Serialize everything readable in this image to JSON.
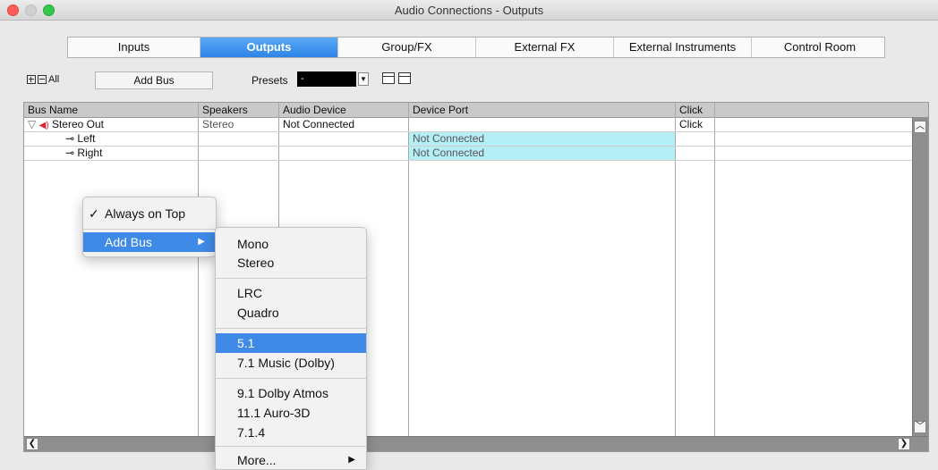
{
  "window": {
    "title": "Audio Connections - Outputs"
  },
  "tabs": [
    {
      "label": "Inputs"
    },
    {
      "label": "Outputs"
    },
    {
      "label": "Group/FX"
    },
    {
      "label": "External FX"
    },
    {
      "label": "External Instruments"
    },
    {
      "label": "Control Room"
    }
  ],
  "toolbar": {
    "all_label": "All",
    "add_bus_label": "Add Bus",
    "presets_label": "Presets",
    "presets_value": "-"
  },
  "table": {
    "headers": [
      "Bus Name",
      "Speakers",
      "Audio Device",
      "Device Port",
      "Click"
    ],
    "rows": [
      {
        "bus": "Stereo Out",
        "speakers": "Stereo",
        "device": "Not Connected",
        "port": "",
        "click": "Click"
      },
      {
        "bus": "Left",
        "speakers": "",
        "device": "",
        "port": "Not Connected",
        "click": ""
      },
      {
        "bus": "Right",
        "speakers": "",
        "device": "",
        "port": "Not Connected",
        "click": ""
      }
    ]
  },
  "context_menu": {
    "items": [
      {
        "label": "Always on Top",
        "checked": true
      },
      {
        "label": "Add Bus"
      }
    ]
  },
  "submenu": {
    "items": [
      "Mono",
      "Stereo",
      "LRC",
      "Quadro",
      "5.1",
      "7.1 Music (Dolby)",
      "9.1 Dolby Atmos",
      "11.1 Auro-3D",
      "7.1.4",
      "More..."
    ],
    "selected": "5.1"
  },
  "icons": {
    "expand": "plus-box-icon",
    "collapse": "minus-box-icon",
    "speaker": "speaker-icon",
    "disclosure": "disclosure-triangle-icon",
    "port": "port-connector-icon",
    "scroll_up": "scroll-up-arrow-icon",
    "scroll_down": "scroll-down-arrow-icon",
    "scroll_left": "scroll-left-arrow-icon",
    "scroll_right": "scroll-right-arrow-icon",
    "submenu_arrow": "submenu-arrow-icon"
  },
  "colors": {
    "tab_active": "#2d84e8",
    "menu_selection": "#3f8ae6",
    "port_cell": "#b6eef6",
    "close": "#fc5f57",
    "zoom": "#34c84a"
  }
}
